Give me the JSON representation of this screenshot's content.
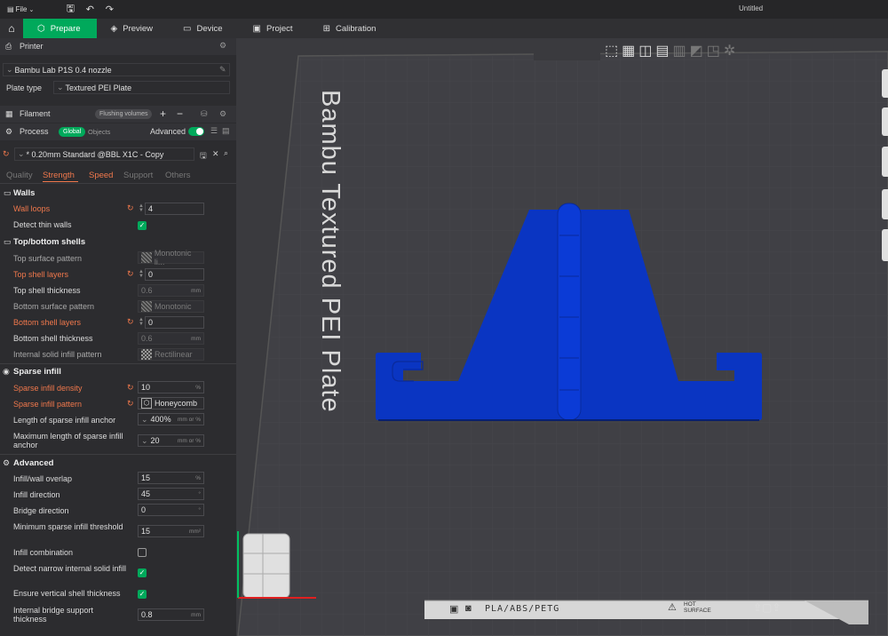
{
  "titlebar": {
    "file_label": "File",
    "document_title": "Untitled"
  },
  "tabs": [
    {
      "label": "Prepare"
    },
    {
      "label": "Preview"
    },
    {
      "label": "Device"
    },
    {
      "label": "Project"
    },
    {
      "label": "Calibration"
    }
  ],
  "printer": {
    "section_label": "Printer",
    "name": "Bambu Lab P1S 0.4 nozzle",
    "plate_type_label": "Plate type",
    "plate_type_value": "Textured PEI Plate"
  },
  "filament": {
    "section_label": "Filament",
    "flushing_button": "Flushing volumes"
  },
  "process": {
    "section_label": "Process",
    "global_label": "Global",
    "objects_label": "Objects",
    "advanced_label": "Advanced",
    "preset": "* 0.20mm Standard @BBL X1C - Copy"
  },
  "setting_tabs": [
    "Quality",
    "Strength",
    "Speed",
    "Support",
    "Others"
  ],
  "walls": {
    "heading": "Walls",
    "wall_loops_label": "Wall loops",
    "wall_loops_value": "4",
    "detect_thin_label": "Detect thin walls"
  },
  "topbottom": {
    "heading": "Top/bottom shells",
    "top_pattern_label": "Top surface pattern",
    "top_pattern_value": "Monotonic li...",
    "top_layers_label": "Top shell layers",
    "top_layers_value": "0",
    "top_thick_label": "Top shell thickness",
    "top_thick_value": "0.6",
    "top_thick_unit": "mm",
    "bottom_pattern_label": "Bottom surface pattern",
    "bottom_pattern_value": "Monotonic",
    "bottom_layers_label": "Bottom shell layers",
    "bottom_layers_value": "0",
    "bottom_thick_label": "Bottom shell thickness",
    "bottom_thick_value": "0.6",
    "bottom_thick_unit": "mm",
    "internal_solid_label": "Internal solid infill pattern",
    "internal_solid_value": "Rectilinear"
  },
  "sparse": {
    "heading": "Sparse infill",
    "density_label": "Sparse infill density",
    "density_value": "10",
    "density_unit": "%",
    "pattern_label": "Sparse infill pattern",
    "pattern_value": "Honeycomb",
    "anchor_label": "Length of sparse infill anchor",
    "anchor_value": "400%",
    "anchor_unit": "mm or %",
    "max_anchor_label": "Maximum length of sparse infill anchor",
    "max_anchor_value": "20",
    "max_anchor_unit": "mm or %"
  },
  "advanced": {
    "heading": "Advanced",
    "overlap_label": "Infill/wall overlap",
    "overlap_value": "15",
    "overlap_unit": "%",
    "direction_label": "Infill direction",
    "direction_value": "45",
    "direction_unit": "°",
    "bridge_label": "Bridge direction",
    "bridge_value": "0",
    "bridge_unit": "°",
    "min_sparse_label": "Minimum sparse infill threshold",
    "min_sparse_value": "15",
    "min_sparse_unit": "mm²",
    "combination_label": "Infill combination",
    "narrow_label": "Detect narrow internal solid infill",
    "vertical_label": "Ensure vertical shell thickness",
    "bridge_support_label": "Internal bridge support thickness",
    "bridge_support_value": "0.8",
    "bridge_support_unit": "mm"
  },
  "viewport": {
    "plate_label": "Bambu Textured PEI Plate",
    "bottom_badge": "PLA/ABS/PETG",
    "hot_label_1": "HOT",
    "hot_label_2": "SURFACE",
    "model_color": "#0a35c2"
  }
}
